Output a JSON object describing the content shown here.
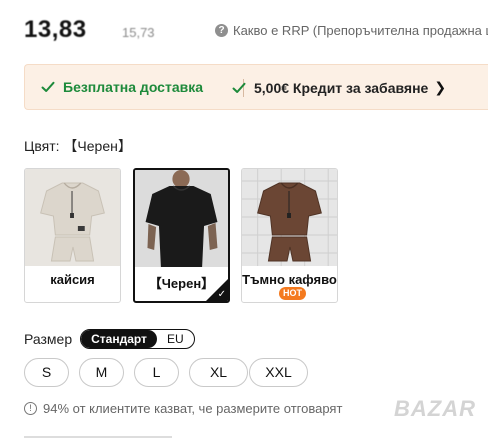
{
  "price": {
    "main": "13,83",
    "rrp_value": "15,73",
    "rrp_link": "Какво е RRP (Препоръчителна продажна ц"
  },
  "benefits": {
    "free_shipping": "Безплатна доставка",
    "credit": "5,00€ Кредит за забавяне"
  },
  "color": {
    "label": "Цвят:",
    "selected": "【Черен】",
    "options": [
      {
        "label": "кайсия",
        "color": "#dcd6cc",
        "selected": false,
        "badge": ""
      },
      {
        "label": "【Черен】",
        "color": "#1a1a1a",
        "selected": true,
        "badge": ""
      },
      {
        "label": "Тъмно кафяво",
        "color": "#6b4634",
        "selected": false,
        "badge": "HOT"
      }
    ]
  },
  "size": {
    "label": "Размер",
    "toggle": [
      "Стандарт",
      "EU"
    ],
    "toggle_active": "Стандарт",
    "options": [
      "S",
      "M",
      "L",
      "XL",
      "XXL"
    ]
  },
  "fit_note": "94% от клиентите казват, че размерите отговарят",
  "watermark": "BAZAR",
  "colors": {
    "accent_green": "#1d8a3b",
    "benefit_bg": "#fcf0e5",
    "hot": "#f47a1f"
  }
}
